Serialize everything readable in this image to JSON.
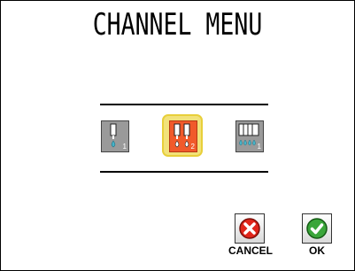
{
  "title": "CHANNEL MENU",
  "channels": [
    {
      "label": "1",
      "state": "unselected"
    },
    {
      "label": "2",
      "state": "selected"
    },
    {
      "label": "1",
      "state": "unselected"
    }
  ],
  "buttons": {
    "cancel_label": "CANCEL",
    "ok_label": "OK"
  },
  "colors": {
    "selected_fill": "#f15a2b",
    "selected_highlight": "#f2e27a",
    "unselected_fill": "#9a9a9a",
    "drop_color": "#47b3c8",
    "cancel_icon": "#e0261b",
    "ok_icon": "#3aa63a"
  },
  "icons": {
    "channel_1": "single-pipette-icon",
    "channel_2": "dual-pipette-icon",
    "channel_3": "multi-pipette-icon",
    "cancel": "x-circle-icon",
    "ok": "check-circle-icon"
  }
}
